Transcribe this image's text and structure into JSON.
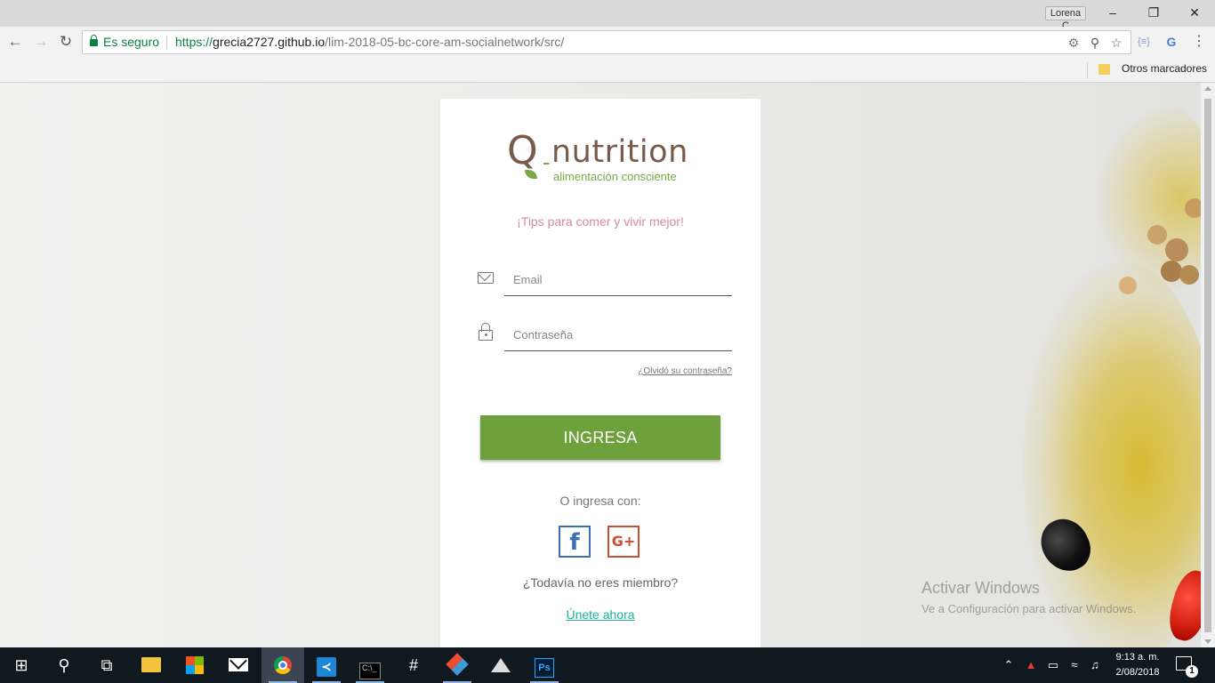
{
  "browser": {
    "user_name": "Lorena C",
    "secure_label": "Es seguro",
    "url_scheme": "https://",
    "url_host": "grecia2727.github.io",
    "url_path": "/lim-2018-05-bc-core-am-socialnetwork/src/",
    "bookmark_folder": "Otros marcadores"
  },
  "brand": {
    "logo_letter": "Q",
    "logo_dash": "-",
    "logo_name": "nutrition",
    "logo_tagline": "alimentación consciente",
    "tagline": "¡Tips para comer y vivir mejor!"
  },
  "login": {
    "email_placeholder": "Email",
    "password_placeholder": "Contraseña",
    "forgot_link": "¿Olvidó su contraseña?",
    "submit_label": "INGRESA",
    "alt_login_label": "O ingresa con:",
    "facebook_glyph": "f",
    "google_glyph": "G+",
    "member_question": "¿Todavía no eres miembro?",
    "join_link": "Únete ahora"
  },
  "watermark": {
    "title": "Activar Windows",
    "subtitle": "Ve a Configuración para activar Windows."
  },
  "taskbar": {
    "time": "9:13 a. m.",
    "date": "2/08/2018",
    "notification_count": "1"
  },
  "colors": {
    "brand_brown": "#7a5a4a",
    "brand_green": "#7aa845",
    "button_green": "#6ea03c",
    "tagline_pink": "#d68aa3",
    "link_teal": "#1ab394",
    "facebook_blue": "#3b70b2",
    "google_red": "#d04a2e"
  }
}
